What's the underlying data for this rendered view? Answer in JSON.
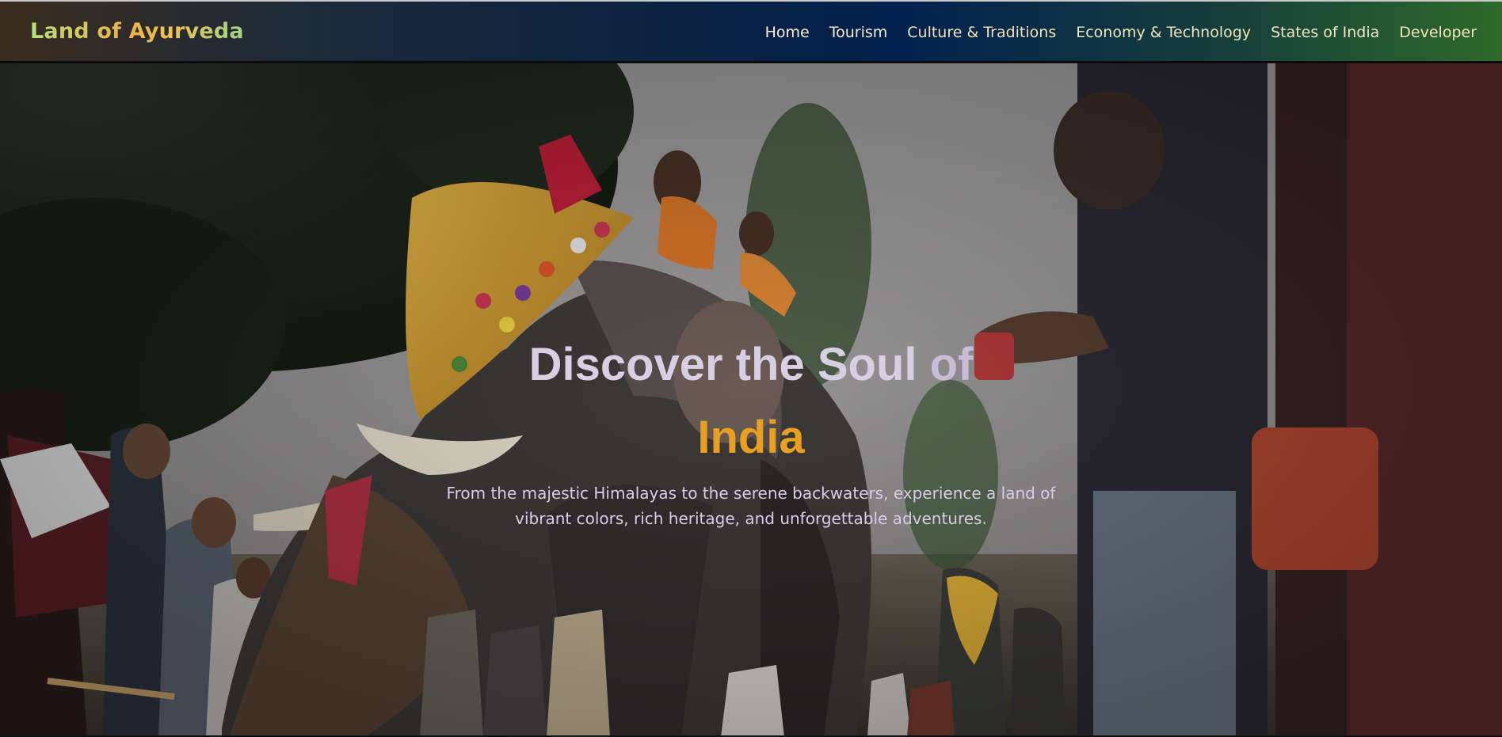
{
  "header": {
    "brand": "Land of Ayurveda",
    "nav": [
      {
        "label": "Home"
      },
      {
        "label": "Tourism"
      },
      {
        "label": "Culture & Traditions"
      },
      {
        "label": "Economy & Technology"
      },
      {
        "label": "States of India"
      },
      {
        "label": "Developer"
      }
    ]
  },
  "hero": {
    "title_part1": "Discover the Soul",
    "title_part2": "of",
    "title_accent": "India",
    "subtitle": "From the majestic Himalayas to the serene backwaters, experience a land of vibrant colors, rich heritage, and unforgettable adventures.",
    "background_description_icon": "elephant-festival-photo"
  },
  "colors": {
    "accent": "#e7a020",
    "nav_text": "#f3e8c8",
    "nav_gradient_start": "#3a2c1f",
    "nav_gradient_mid": "#02214f",
    "nav_gradient_end": "#2e6a2b"
  }
}
